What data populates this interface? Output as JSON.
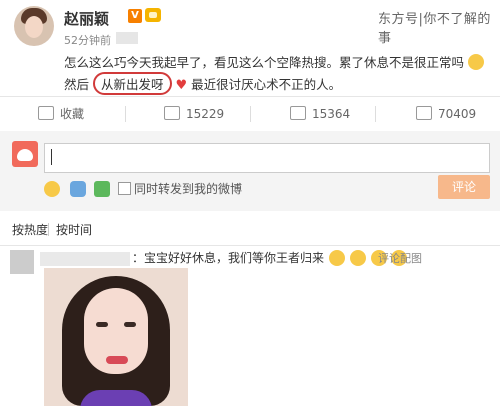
{
  "post": {
    "username": "赵丽颖",
    "verified_badge": "V",
    "watermark": "东方号|你不了解的事",
    "time": "52分钟前",
    "line1": "怎么这么巧今天我起早了，看见这么个空降热搜。累了休息不是很正常吗",
    "line2_prefix": "然后",
    "line2_circled": "从新出发呀",
    "line2_suffix": "最近很讨厌心术不正的人。"
  },
  "actions": {
    "favorite": "收藏",
    "repost_count": "15229",
    "comment_count": "15364",
    "like_count": "70409"
  },
  "composer": {
    "repost_label": "同时转发到我的微博",
    "submit_label": "评论",
    "colors": {
      "submit_bg": "#f7b88b",
      "accent": "#f78000"
    }
  },
  "tabs": {
    "hot": "按热度",
    "time": "按时间"
  },
  "comment": {
    "text": "：宝宝好好休息，我们等你王者归来",
    "report": "评论配图"
  }
}
